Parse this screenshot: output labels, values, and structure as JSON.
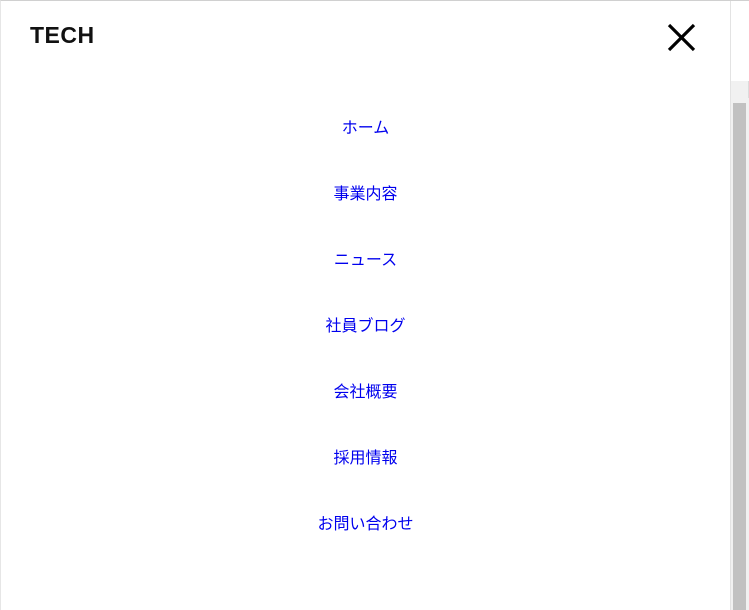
{
  "header": {
    "logo_text": "TECH",
    "close_icon": "close-icon"
  },
  "nav": {
    "items": [
      {
        "label": "ホーム"
      },
      {
        "label": "事業内容"
      },
      {
        "label": "ニュース"
      },
      {
        "label": "社員ブログ"
      },
      {
        "label": "会社概要"
      },
      {
        "label": "採用情報"
      },
      {
        "label": "お問い合わせ"
      }
    ]
  },
  "colors": {
    "link": "#0000ee",
    "logo": "#111111",
    "scrollbar_thumb": "#c1c1c1"
  }
}
